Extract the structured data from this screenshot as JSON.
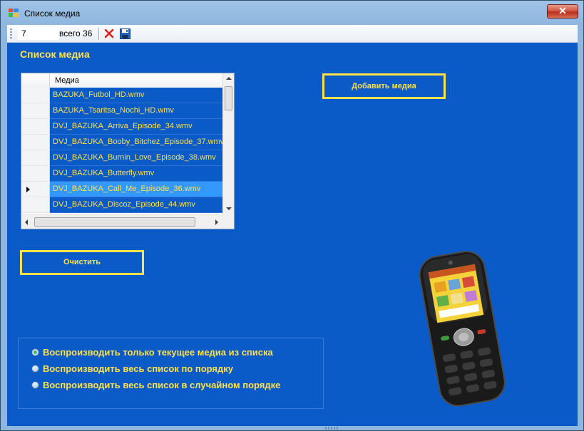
{
  "window": {
    "title": "Список медиа",
    "close_label": "✕"
  },
  "toolbar": {
    "page_value": "7",
    "total_label": "всего 36"
  },
  "main": {
    "heading": "Список медиа",
    "grid": {
      "column_header": "Медиа",
      "rows": [
        "BAZUKA_Futbol_HD.wmv",
        "BAZUKA_Tsaritsa_Nochi_HD.wmv",
        "DVJ_BAZUKA_Arriva_Episode_34.wmv",
        "DVJ_BAZUKA_Booby_Bitchez_Episode_37.wmv",
        "DVJ_BAZUKA_Burnin_Love_Episode_38.wmv",
        "DVJ_BAZUKA_Butterfly.wmv",
        "DVJ_BAZUKA_Call_Me_Episode_36.wmv",
        "DVJ_BAZUKA_Discoz_Episode_44.wmv"
      ],
      "current_row": 6
    },
    "add_button": "Добавить медиа",
    "clear_button": "Очистить",
    "playback_modes": [
      "Воспроизводить только текущее медиа из списка",
      "Воспроизводить весь список по порядку",
      "Воспроизводить весь список в случайном порядке"
    ],
    "selected_mode": 0
  },
  "colors": {
    "background": "#0a5ac8",
    "accent": "#ffe14a",
    "row_selected": "#3399ff"
  },
  "icons": {
    "delete": "red-x-icon",
    "save": "floppy-disk-icon",
    "phone": "mobile-phone-image"
  }
}
